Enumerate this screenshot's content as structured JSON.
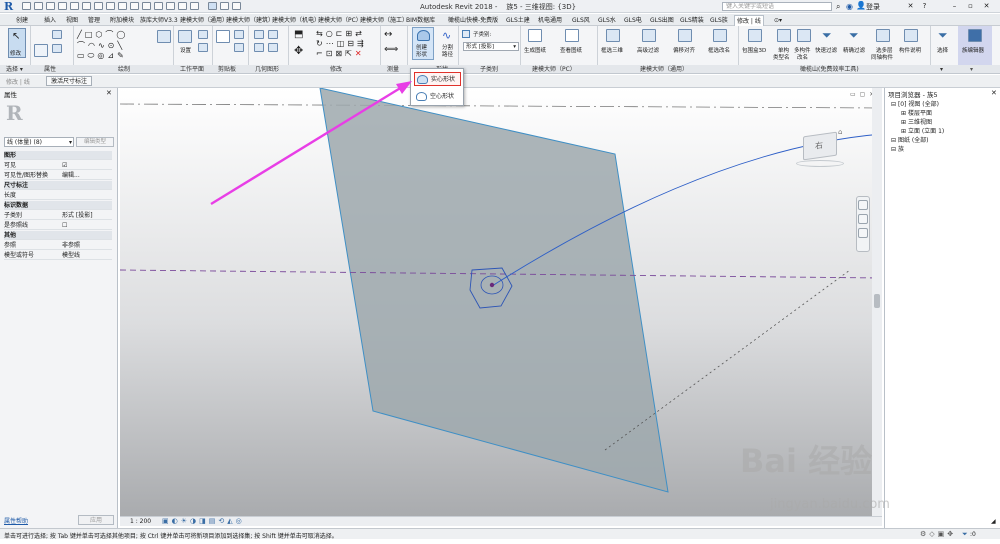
{
  "app": {
    "title": "Autodesk Revit 2018 -",
    "document": "族5 - 三维视图: {3D}",
    "search_placeholder": "键入关键字或短语",
    "login": "登录"
  },
  "tabs": [
    "创建",
    "插入",
    "视图",
    "管理",
    "附加模块",
    "族库大师V3.3",
    "建模大师（通用）",
    "建模大师（建筑）",
    "建模大师（机电）",
    "建模大师（PC）",
    "建模大师（施工）",
    "BIM数据库",
    "橄榄山快模-免费版",
    "GLS土建",
    "机电通用",
    "GLS风",
    "GLS水",
    "GLS电",
    "GLS出图",
    "GLS精装",
    "GLS族",
    "修改 | 线"
  ],
  "active_tab": "修改 | 线",
  "ribbon": {
    "modify_label": "修改",
    "settings_label": "设置",
    "create_form_label": "创建\n形状",
    "create_form_l1": "创建",
    "create_form_l2": "形状",
    "split_path_l1": "分割",
    "split_path_l2": "路径",
    "subcategory_label": "子类别:",
    "subcategory_value": "形式 [投影]",
    "generate_drawing": "生成图纸",
    "view_drawing": "查看图纸",
    "filter_3d": "框选三维",
    "advanced_filter": "高级过滤",
    "align_offset": "偏移对齐",
    "filter_rename": "框选改名",
    "bbox_3d": "包围盒3D",
    "single_type_l1": "单构",
    "single_type_l2": "类型名",
    "multi_type_l1": "多构件",
    "multi_type_l2": "改名",
    "quick_filter": "快速过滤",
    "precise_filter": "精确过滤",
    "select_layers_l1": "选多层",
    "select_layers_l2": "同轴构件",
    "component_desc": "构件说明",
    "select_label": "选择",
    "family_editor_l1": "族编辑器"
  },
  "groups": {
    "select": "选择 ▾",
    "properties": "属性",
    "draw": "绘制",
    "work_plane": "工作平面",
    "clipboard": "剪贴板",
    "geometry": "几何图形",
    "modify": "修改",
    "measure": "测量",
    "form": "形状",
    "subcategory": "子类别",
    "jianmo_pc": "建模大师（PC）",
    "jianmo_general": "建模大师（通用）",
    "gls_tools": "橄榄山(免费效率工具)",
    "edit_family": "族编辑器"
  },
  "optionbar": {
    "left": "修改 | 线",
    "activate_dims": "激活尺寸标注"
  },
  "dropdown": {
    "solid_form": "实心形状",
    "void_form": "空心形状"
  },
  "properties": {
    "title": "属性",
    "type_selector": "线 (体量) (8)",
    "edit_type": "编辑类型",
    "rows": [
      {
        "label": "图形",
        "value": "",
        "head": true
      },
      {
        "label": "可见",
        "value": "☑",
        "head": false
      },
      {
        "label": "可见性/图形替换",
        "value": "编辑...",
        "head": false
      },
      {
        "label": "尺寸标注",
        "value": "",
        "head": true
      },
      {
        "label": "长度",
        "value": "",
        "head": false
      },
      {
        "label": "标识数据",
        "value": "",
        "head": true
      },
      {
        "label": "子类别",
        "value": "形式 [投影]",
        "head": false
      },
      {
        "label": "是参照线",
        "value": "☐",
        "head": false
      },
      {
        "label": "其他",
        "value": "",
        "head": true
      },
      {
        "label": "参照",
        "value": "非参照",
        "head": false
      },
      {
        "label": "模型或符号",
        "value": "模型线",
        "head": false
      }
    ],
    "help_link": "属性帮助",
    "apply": "应用"
  },
  "browser": {
    "title": "项目浏览器 - 族5",
    "items": [
      {
        "label": "[0] 视图 (全部)",
        "indent": 0
      },
      {
        "label": "楼层平面",
        "indent": 1
      },
      {
        "label": "三维视图",
        "indent": 1
      },
      {
        "label": "立面 (立面 1)",
        "indent": 1
      },
      {
        "label": "图纸 (全部)",
        "indent": 0
      },
      {
        "label": "族",
        "indent": 0
      }
    ]
  },
  "viewbar": {
    "scale": "1 : 200"
  },
  "viewcube": {
    "face": "右"
  },
  "status": {
    "text": "单击可进行选择; 按 Tab 键并单击可选择其他项目; 按 Ctrl 键并单击可将新项目添加到选择集; 按 Shift 键并单击可取消选择。",
    "right_count": ":0"
  },
  "watermark": {
    "main": "Bai 经验",
    "sub": "jingyan.baidu.com"
  },
  "colors": {
    "accent": "#1e5aa8",
    "arrow": "#e83ee6",
    "highlight": "#e0322b",
    "plane_fill": "#9ea8ad",
    "plane_edge": "#3f8fc5",
    "path_line": "#2e5fc7",
    "ref_line": "#7a4a9a"
  }
}
